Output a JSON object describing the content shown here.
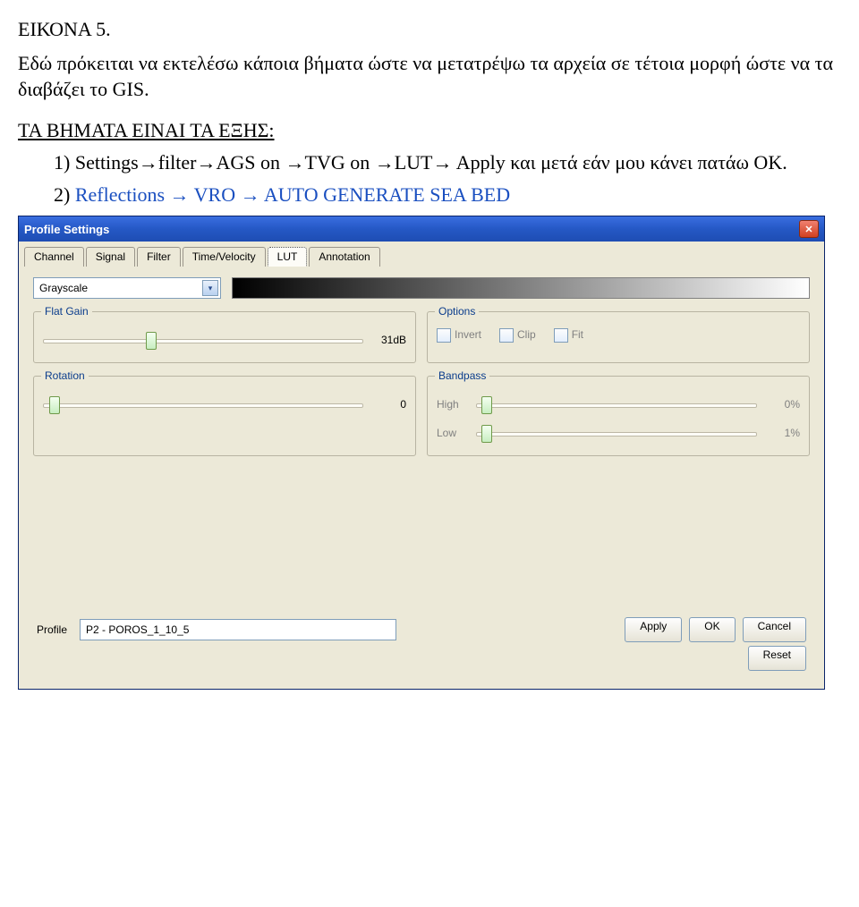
{
  "doc": {
    "image_heading": "ΕΙΚΟΝΑ 5.",
    "intro": "Εδώ πρόκειται να εκτελέσω κάποια βήματα  ώστε να μετατρέψω τα αρχεία σε τέτοια μορφή ώστε να τα διαβάζει το GIS.",
    "steps_heading": "ΤΑ ΒΗΜΑΤΑ ΕΙΝΑΙ ΤΑ ΕΞΗΣ:",
    "step1_num": "1)",
    "step1_a": "Settings",
    "step1_b": "filter",
    "step1_c": "AGS on ",
    "step1_d": "TVG on ",
    "step1_e": "LUT",
    "step1_f": " Apply και μετά εάν μου κάνει πατάω ΟΚ.",
    "step2_num": "2)",
    "step2_a": "Reflections ",
    "step2_b": " VRO ",
    "step2_c": " AUTO GENERATE SEA BED",
    "arrow": "→"
  },
  "dialog": {
    "title": "Profile Settings",
    "tabs": [
      "Channel",
      "Signal",
      "Filter",
      "Time/Velocity",
      "LUT",
      "Annotation"
    ],
    "active_tab_index": 4,
    "palette_selected": "Grayscale",
    "groups": {
      "flat_gain": {
        "label": "Flat Gain",
        "value": "31dB",
        "thumb_pct": 32
      },
      "options": {
        "label": "Options",
        "invert": "Invert",
        "clip": "Clip",
        "fit": "Fit"
      },
      "rotation": {
        "label": "Rotation",
        "value": "0",
        "thumb_pct": 2
      },
      "bandpass": {
        "label": "Bandpass",
        "high_label": "High",
        "high_value": "0%",
        "high_thumb_pct": 2,
        "low_label": "Low",
        "low_value": "1%",
        "low_thumb_pct": 2
      }
    },
    "footer": {
      "profile_label": "Profile",
      "profile_value": "P2 - POROS_1_10_5",
      "apply": "Apply",
      "ok": "OK",
      "cancel": "Cancel",
      "reset": "Reset"
    }
  }
}
